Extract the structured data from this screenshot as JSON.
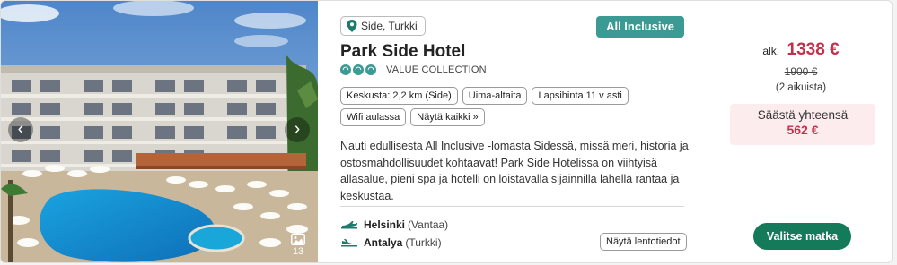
{
  "gallery": {
    "photo_count": "13"
  },
  "hotel": {
    "location": "Side, Turkki",
    "badge": "All Inclusive",
    "name": "Park Side Hotel",
    "collection": "VALUE COLLECTION",
    "rating_suns": 3,
    "description": "Nauti edullisesta All Inclusive -lomasta Sidessä, missä meri, historia ja ostosmahdollisuudet kohtaavat! Park Side Hotelissa on viihtyisä allasalue, pieni spa ja hotelli on loistavalla sijainnilla lähellä rantaa ja keskustaa."
  },
  "features": [
    "Keskusta: 2,2 km (Side)",
    "Uima-altaita",
    "Lapsihinta 11 v asti",
    "Wifi aulassa"
  ],
  "show_all_label": "Näytä kaikki »",
  "flights": {
    "departure": {
      "city": "Helsinki",
      "airport": "(Vantaa)"
    },
    "arrival": {
      "city": "Antalya",
      "airport": "(Turkki)"
    },
    "details_label": "Näytä lentotiedot"
  },
  "price": {
    "from_label": "alk.",
    "amount": "1338 €",
    "original": "1900 €",
    "persons": "(2 aikuista)",
    "save_label": "Säästä yhteensä",
    "save_amount": "562 €"
  },
  "cta_label": "Valitse matka",
  "colors": {
    "accent_teal": "#3b9a93",
    "price_red": "#c3304a",
    "cta_green": "#157a5a",
    "save_bg": "#fcecee"
  }
}
